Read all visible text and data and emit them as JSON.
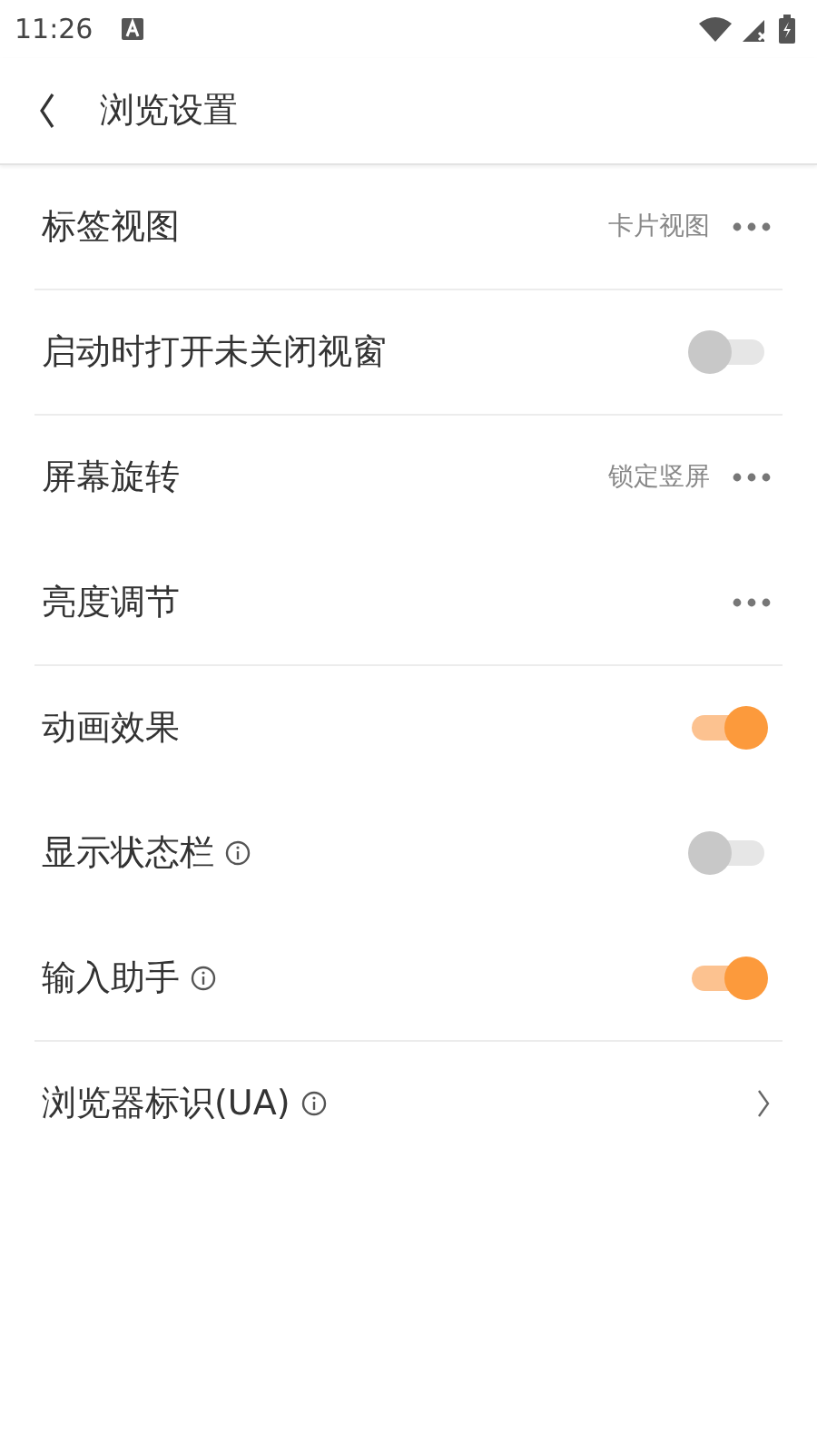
{
  "status_bar": {
    "time": "11:26"
  },
  "header": {
    "title": "浏览设置"
  },
  "settings": [
    {
      "kind": "option",
      "label": "标签视图",
      "value": "卡片视图",
      "info": false,
      "divider": true
    },
    {
      "kind": "toggle",
      "label": "启动时打开未关闭视窗",
      "on": false,
      "info": false,
      "divider": true
    },
    {
      "kind": "option",
      "label": "屏幕旋转",
      "value": "锁定竖屏",
      "info": false,
      "divider": false
    },
    {
      "kind": "option",
      "label": "亮度调节",
      "info": false,
      "divider": true
    },
    {
      "kind": "toggle",
      "label": "动画效果",
      "on": true,
      "info": false,
      "divider": false
    },
    {
      "kind": "toggle",
      "label": "显示状态栏",
      "on": false,
      "info": true,
      "divider": false
    },
    {
      "kind": "toggle",
      "label": "输入助手",
      "on": true,
      "info": true,
      "divider": true
    },
    {
      "kind": "link",
      "label": "浏览器标识(UA)",
      "info": true,
      "divider": false
    }
  ]
}
